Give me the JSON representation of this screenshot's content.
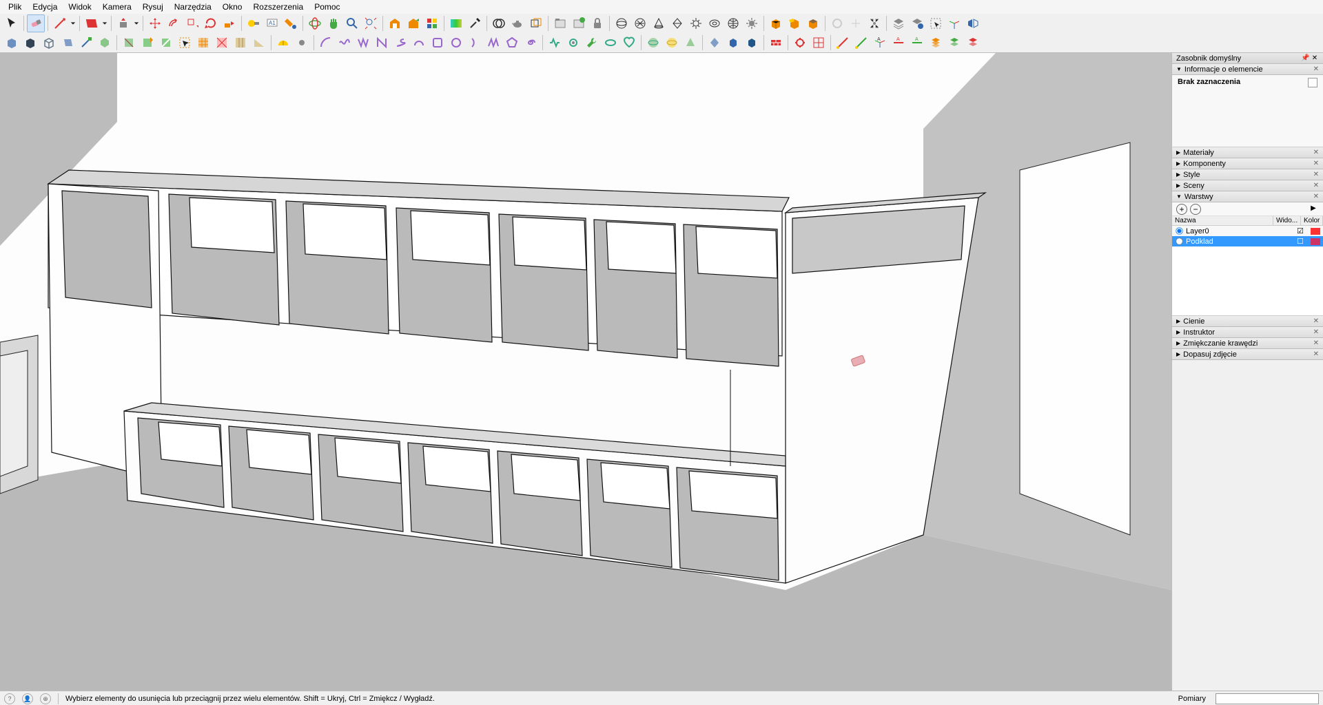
{
  "menu": [
    "Plik",
    "Edycja",
    "Widok",
    "Kamera",
    "Rysuj",
    "Narzędzia",
    "Okno",
    "Rozszerzenia",
    "Pomoc"
  ],
  "tray": {
    "title": "Zasobnik domyślny",
    "entity_info": {
      "header": "Informacje o elemencie",
      "status": "Brak zaznaczenia"
    },
    "panels_middle": [
      "Materiały",
      "Komponenty",
      "Style",
      "Sceny",
      "Warstwy"
    ],
    "panels_bottom": [
      "Cienie",
      "Instruktor",
      "Zmiękczanie krawędzi",
      "Dopasuj zdjęcie"
    ],
    "layers": {
      "columns": {
        "name": "Nazwa",
        "visible": "Wido...",
        "color": "Kolor"
      },
      "rows": [
        {
          "name": "Layer0",
          "visible": true,
          "color": "#ff3333",
          "active": true,
          "selected": false
        },
        {
          "name": "Podklad",
          "visible": false,
          "color": "#cc3366",
          "active": false,
          "selected": true
        }
      ]
    }
  },
  "status": {
    "hint": "Wybierz elementy do usunięcia lub przeciągnij przez wielu elementów. Shift = Ukryj, Ctrl = Zmiękcz / Wygładź.",
    "measure_label": "Pomiary"
  },
  "active_tool": "eraser"
}
